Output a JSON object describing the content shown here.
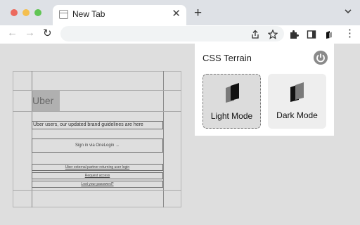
{
  "browser": {
    "tab": {
      "title": "New Tab",
      "close_glyph": "✕",
      "favicon": "new-tab-page-icon"
    },
    "new_tab_glyph": "+",
    "nav": {
      "back_glyph": "←",
      "forward_glyph": "→",
      "reload_glyph": "↻"
    },
    "menu_glyph": "⋮",
    "traffic_lights": {
      "close": "#ec6a5e",
      "minimize": "#f4bf4f",
      "maximize": "#61c554"
    }
  },
  "page": {
    "logo": "Uber",
    "banner": "Uber users, our updated brand guidelines are here",
    "sign_in": "Sign in via OneLogin →",
    "links": [
      "Uber external partner returning user login",
      "Request access",
      "Lost your password?"
    ]
  },
  "extension_popup": {
    "title": "CSS Terrain",
    "modes": [
      {
        "label": "Light Mode",
        "selected": true
      },
      {
        "label": "Dark Mode",
        "selected": false
      }
    ]
  }
}
